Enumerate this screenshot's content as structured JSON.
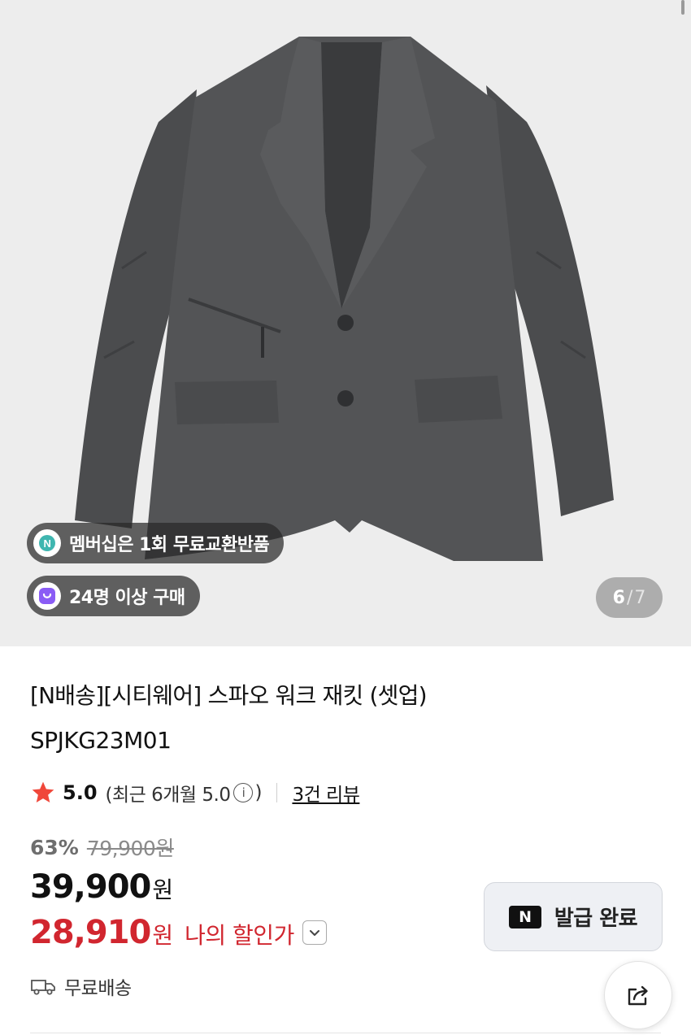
{
  "hero": {
    "membership_badge": "멤버십은 1회 무료교환반품",
    "buyers_badge": "24명 이상 구매",
    "image_counter": {
      "current": "6",
      "separator": "/",
      "total": "7"
    }
  },
  "product": {
    "title": "[N배송][시티웨어] 스파오 워크 재킷 (셋업)",
    "sku": "SPJKG23M01"
  },
  "rating": {
    "score": "5.0",
    "recent_prefix": "(최근 6개월 5.0",
    "recent_suffix": ")",
    "info_glyph": "i",
    "review_link": "3건 리뷰"
  },
  "pricing": {
    "discount_rate": "63%",
    "original_price": "79,900원",
    "price": "39,900",
    "price_unit": "원",
    "my_price": "28,910",
    "my_price_unit": "원",
    "my_price_label": "나의 할인가"
  },
  "coupon": {
    "badge": "N",
    "label": "발급 완료"
  },
  "shipping": {
    "label": "무료배송"
  },
  "colors": {
    "accent_red": "#d1262f",
    "membership_icon": "#3fb6b0",
    "buyers_icon": "#8a5cf5"
  },
  "icons": [
    "star-icon",
    "info-icon",
    "chevron-down-icon",
    "truck-icon",
    "share-icon"
  ]
}
